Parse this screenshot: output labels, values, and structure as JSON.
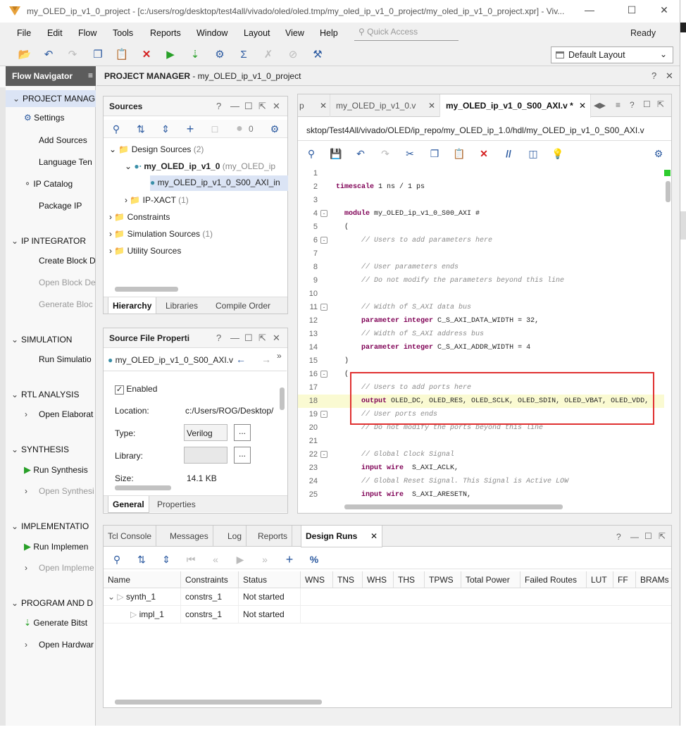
{
  "window": {
    "title": "my_OLED_ip_v1_0_project - [c:/users/rog/desktop/test4all/vivado/oled/oled.tmp/my_oled_ip_v1_0_project/my_oled_ip_v1_0_project.xpr] - Viv..."
  },
  "menu": [
    "File",
    "Edit",
    "Flow",
    "Tools",
    "Reports",
    "Window",
    "Layout",
    "View",
    "Help"
  ],
  "quick_access": {
    "placeholder": "Quick Access"
  },
  "status": "Ready",
  "layout_select": {
    "value": "Default Layout"
  },
  "flow_navigator": {
    "title": "Flow Navigator",
    "sections": {
      "project_manager": {
        "label": "PROJECT MANAG",
        "items": [
          "Settings",
          "Add Sources",
          "Language Ten",
          "IP Catalog",
          "Package IP"
        ]
      },
      "ip_integrator": {
        "label": "IP INTEGRATOR",
        "items": [
          "Create Block D",
          "Open Block De",
          "Generate Bloc"
        ]
      },
      "simulation": {
        "label": "SIMULATION",
        "items": [
          "Run Simulatio"
        ]
      },
      "rtl_analysis": {
        "label": "RTL ANALYSIS",
        "items": [
          "Open Elaborat"
        ]
      },
      "synthesis": {
        "label": "SYNTHESIS",
        "items": [
          "Run Synthesis",
          "Open Synthesi"
        ]
      },
      "implementation": {
        "label": "IMPLEMENTATIO",
        "items": [
          "Run Implemen",
          "Open Impleme"
        ]
      },
      "program": {
        "label": "PROGRAM AND D",
        "items": [
          "Generate Bitst",
          "Open Hardwar"
        ]
      }
    }
  },
  "project_manager_header": {
    "bold": "PROJECT MANAGER",
    "rest": " - my_OLED_ip_v1_0_project"
  },
  "sources": {
    "title": "Sources",
    "count": "0",
    "tree": {
      "design_sources": "Design Sources",
      "design_sources_count": "(2)",
      "top_module": "my_OLED_ip_v1_0",
      "top_module_file": "(my_OLED_ip",
      "child": "my_OLED_ip_v1_0_S00_AXI_in",
      "ip_xact": "IP-XACT",
      "ip_xact_count": "(1)",
      "constraints": "Constraints",
      "simulation_sources": "Simulation Sources",
      "simulation_sources_count": "(1)",
      "utility_sources": "Utility Sources"
    },
    "tabs": [
      "Hierarchy",
      "Libraries",
      "Compile Order"
    ]
  },
  "file_props": {
    "title": "Source File Properti",
    "file": "my_OLED_ip_v1_0_S00_AXI.v",
    "enabled_label": "Enabled",
    "location_label": "Location:",
    "location_value": "c:/Users/ROG/Desktop/",
    "type_label": "Type:",
    "type_value": "Verilog",
    "library_label": "Library:",
    "library_value": "",
    "size_label": "Size:",
    "size_value": "14.1 KB",
    "more": "...",
    "tabs": [
      "General",
      "Properties"
    ]
  },
  "editor": {
    "tabs": [
      "p",
      "my_OLED_ip_v1_0.v",
      "my_OLED_ip_v1_0_S00_AXI.v *"
    ],
    "path": "sktop/Test4All/vivado/OLED/ip_repo/my_OLED_ip_1.0/hdl/my_OLED_ip_v1_0_S00_AXI.v",
    "lines": [
      {
        "n": "1",
        "parts": []
      },
      {
        "n": "2",
        "parts": [
          {
            "t": "timescale",
            "c": "kw"
          },
          {
            "t": " 1 ns / 1 ps"
          }
        ]
      },
      {
        "n": "3",
        "parts": []
      },
      {
        "n": "4",
        "fold": "-",
        "parts": [
          {
            "t": "  "
          },
          {
            "t": "module",
            "c": "kw"
          },
          {
            "t": " my_OLED_ip_v1_0_S00_AXI #"
          }
        ]
      },
      {
        "n": "5",
        "parts": [
          {
            "t": "  ("
          }
        ]
      },
      {
        "n": "6",
        "fold": "-",
        "parts": [
          {
            "t": "      "
          },
          {
            "t": "// Users to add parameters here",
            "c": "cm"
          }
        ]
      },
      {
        "n": "7",
        "parts": []
      },
      {
        "n": "8",
        "parts": [
          {
            "t": "      "
          },
          {
            "t": "// User parameters ends",
            "c": "cm"
          }
        ]
      },
      {
        "n": "9",
        "parts": [
          {
            "t": "      "
          },
          {
            "t": "// Do not modify the parameters beyond this line",
            "c": "cm"
          }
        ]
      },
      {
        "n": "10",
        "parts": []
      },
      {
        "n": "11",
        "fold": "-",
        "parts": [
          {
            "t": "      "
          },
          {
            "t": "// Width of S_AXI data bus",
            "c": "cm"
          }
        ]
      },
      {
        "n": "12",
        "parts": [
          {
            "t": "      "
          },
          {
            "t": "parameter integer",
            "c": "kw"
          },
          {
            "t": " C_S_AXI_DATA_WIDTH = 32,"
          }
        ]
      },
      {
        "n": "13",
        "parts": [
          {
            "t": "      "
          },
          {
            "t": "// Width of S_AXI address bus",
            "c": "cm"
          }
        ]
      },
      {
        "n": "14",
        "parts": [
          {
            "t": "      "
          },
          {
            "t": "parameter integer",
            "c": "kw"
          },
          {
            "t": " C_S_AXI_ADDR_WIDTH = 4"
          }
        ]
      },
      {
        "n": "15",
        "parts": [
          {
            "t": "  )"
          }
        ]
      },
      {
        "n": "16",
        "fold": "-",
        "parts": [
          {
            "t": "  ("
          }
        ]
      },
      {
        "n": "17",
        "parts": [
          {
            "t": "      "
          },
          {
            "t": "// Users to add ports here",
            "c": "cm"
          }
        ]
      },
      {
        "n": "18",
        "hl": true,
        "parts": [
          {
            "t": "      "
          },
          {
            "t": "output",
            "c": "kw"
          },
          {
            "t": " OLED_DC, OLED_RES, OLED_SCLK, OLED_SDIN, OLED_VBAT, OLED_VDD,"
          }
        ]
      },
      {
        "n": "19",
        "fold": "-",
        "parts": [
          {
            "t": "      "
          },
          {
            "t": "// User ports ends",
            "c": "cm"
          }
        ]
      },
      {
        "n": "20",
        "parts": [
          {
            "t": "      "
          },
          {
            "t": "// Do not modify the ports beyond this line",
            "c": "cm"
          }
        ]
      },
      {
        "n": "21",
        "parts": []
      },
      {
        "n": "22",
        "fold": "-",
        "parts": [
          {
            "t": "      "
          },
          {
            "t": "// Global Clock Signal",
            "c": "cm"
          }
        ]
      },
      {
        "n": "23",
        "parts": [
          {
            "t": "      "
          },
          {
            "t": "input wire",
            "c": "kw"
          },
          {
            "t": "  S_AXI_ACLK,"
          }
        ]
      },
      {
        "n": "24",
        "parts": [
          {
            "t": "      "
          },
          {
            "t": "// Global Reset Signal. This Signal is Active LOW",
            "c": "cm"
          }
        ]
      },
      {
        "n": "25",
        "parts": [
          {
            "t": "      "
          },
          {
            "t": "input wire",
            "c": "kw"
          },
          {
            "t": "  S_AXI_ARESETN,"
          }
        ]
      }
    ]
  },
  "bottom": {
    "tabs": [
      "Tcl Console",
      "Messages",
      "Log",
      "Reports",
      "Design Runs"
    ],
    "columns": [
      "Name",
      "Constraints",
      "Status",
      "WNS",
      "TNS",
      "WHS",
      "THS",
      "TPWS",
      "Total Power",
      "Failed Routes",
      "LUT",
      "FF",
      "BRAMs"
    ],
    "rows": [
      {
        "name": "synth_1",
        "constraints": "constrs_1",
        "status": "Not started"
      },
      {
        "name": "impl_1",
        "constraints": "constrs_1",
        "status": "Not started"
      }
    ]
  }
}
